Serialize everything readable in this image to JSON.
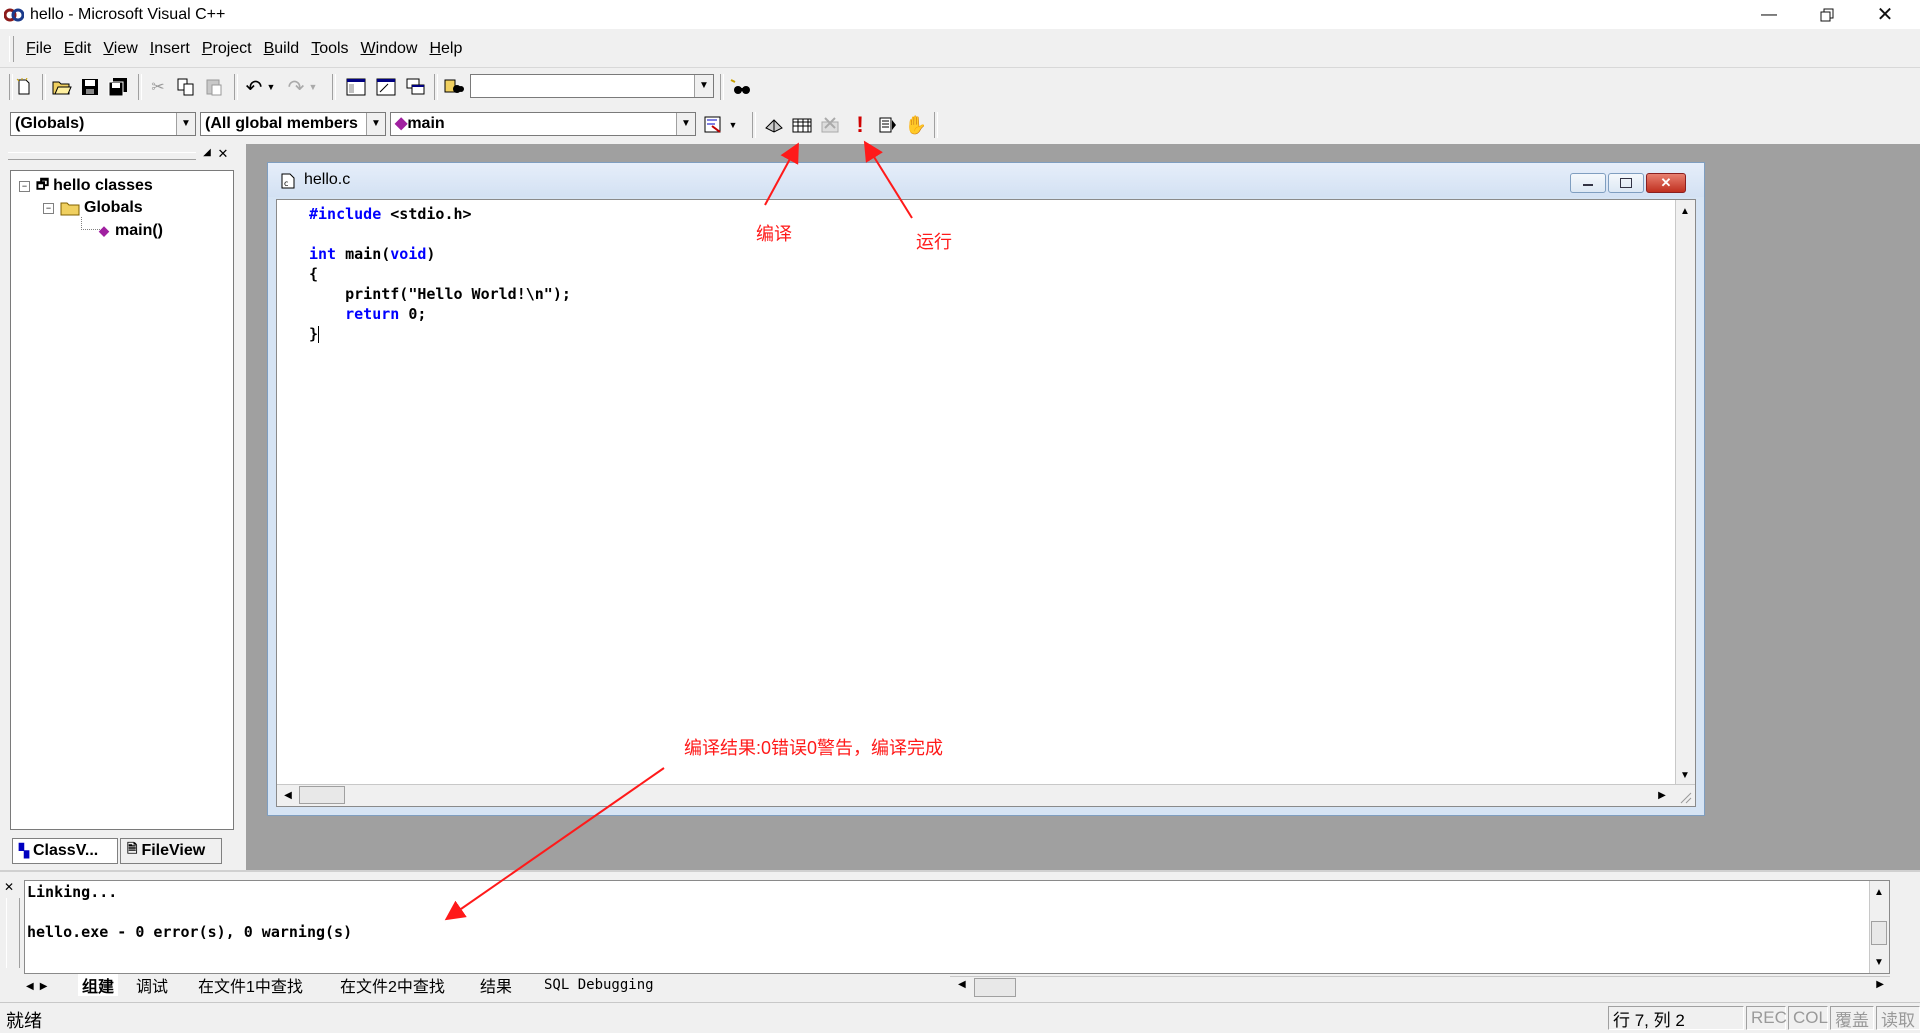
{
  "window": {
    "title": "hello - Microsoft Visual C++"
  },
  "menu": [
    {
      "label": "File",
      "mnemonic": "F"
    },
    {
      "label": "Edit",
      "mnemonic": "E"
    },
    {
      "label": "View",
      "mnemonic": "V"
    },
    {
      "label": "Insert",
      "mnemonic": "I"
    },
    {
      "label": "Project",
      "mnemonic": "P"
    },
    {
      "label": "Build",
      "mnemonic": "B"
    },
    {
      "label": "Tools",
      "mnemonic": "T"
    },
    {
      "label": "Window",
      "mnemonic": "W"
    },
    {
      "label": "Help",
      "mnemonic": "H"
    }
  ],
  "toolbar": {
    "find_value": "",
    "wizard_scope": "(Globals)",
    "wizard_filter": "(All global members",
    "wizard_member": "main"
  },
  "workspace": {
    "root": "hello classes",
    "globals": "Globals",
    "function": "main()",
    "tabs": [
      "ClassV...",
      "FileView"
    ]
  },
  "editor": {
    "filename": "hello.c",
    "lines": [
      {
        "kw": "#include",
        "rest": " <stdio.h>"
      },
      {
        "kw": "",
        "rest": ""
      },
      {
        "kw": "int",
        "rest": " main(",
        "kw2": "void",
        "rest2": ")"
      },
      {
        "kw": "",
        "rest": "{"
      },
      {
        "kw": "",
        "rest": "    printf(\"Hello World!\\n\");"
      },
      {
        "kw": "return",
        "rest": " 0;",
        "indent": "    "
      },
      {
        "kw": "",
        "rest": "}"
      }
    ]
  },
  "output": {
    "lines": [
      "Linking...",
      "",
      "hello.exe - 0 error(s), 0 warning(s)"
    ],
    "tabs": [
      "组建",
      "调试",
      "在文件1中查找",
      "在文件2中查找",
      "结果",
      "SQL Debugging"
    ]
  },
  "status": {
    "message": "就绪",
    "position": "行 7, 列 2",
    "rec": "REC",
    "col": "COL",
    "ovr": "覆盖",
    "read": "读取"
  },
  "annotations": {
    "compile": "编译",
    "run": "运行",
    "result": "编译结果:0错误0警告，编译完成"
  },
  "colors": {
    "annotation": "#ff1a1a",
    "keyword": "#0000ff"
  }
}
